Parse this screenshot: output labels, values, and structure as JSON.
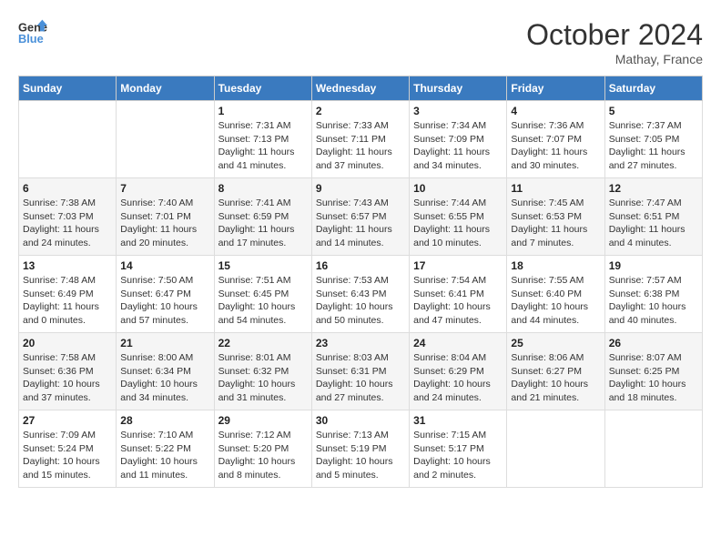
{
  "header": {
    "logo_line1": "General",
    "logo_line2": "Blue",
    "month": "October 2024",
    "location": "Mathay, France"
  },
  "columns": [
    "Sunday",
    "Monday",
    "Tuesday",
    "Wednesday",
    "Thursday",
    "Friday",
    "Saturday"
  ],
  "weeks": [
    [
      {
        "day": "",
        "info": ""
      },
      {
        "day": "",
        "info": ""
      },
      {
        "day": "1",
        "sunrise": "7:31 AM",
        "sunset": "7:13 PM",
        "daylight": "11 hours and 41 minutes."
      },
      {
        "day": "2",
        "sunrise": "7:33 AM",
        "sunset": "7:11 PM",
        "daylight": "11 hours and 37 minutes."
      },
      {
        "day": "3",
        "sunrise": "7:34 AM",
        "sunset": "7:09 PM",
        "daylight": "11 hours and 34 minutes."
      },
      {
        "day": "4",
        "sunrise": "7:36 AM",
        "sunset": "7:07 PM",
        "daylight": "11 hours and 30 minutes."
      },
      {
        "day": "5",
        "sunrise": "7:37 AM",
        "sunset": "7:05 PM",
        "daylight": "11 hours and 27 minutes."
      }
    ],
    [
      {
        "day": "6",
        "sunrise": "7:38 AM",
        "sunset": "7:03 PM",
        "daylight": "11 hours and 24 minutes."
      },
      {
        "day": "7",
        "sunrise": "7:40 AM",
        "sunset": "7:01 PM",
        "daylight": "11 hours and 20 minutes."
      },
      {
        "day": "8",
        "sunrise": "7:41 AM",
        "sunset": "6:59 PM",
        "daylight": "11 hours and 17 minutes."
      },
      {
        "day": "9",
        "sunrise": "7:43 AM",
        "sunset": "6:57 PM",
        "daylight": "11 hours and 14 minutes."
      },
      {
        "day": "10",
        "sunrise": "7:44 AM",
        "sunset": "6:55 PM",
        "daylight": "11 hours and 10 minutes."
      },
      {
        "day": "11",
        "sunrise": "7:45 AM",
        "sunset": "6:53 PM",
        "daylight": "11 hours and 7 minutes."
      },
      {
        "day": "12",
        "sunrise": "7:47 AM",
        "sunset": "6:51 PM",
        "daylight": "11 hours and 4 minutes."
      }
    ],
    [
      {
        "day": "13",
        "sunrise": "7:48 AM",
        "sunset": "6:49 PM",
        "daylight": "11 hours and 0 minutes."
      },
      {
        "day": "14",
        "sunrise": "7:50 AM",
        "sunset": "6:47 PM",
        "daylight": "10 hours and 57 minutes."
      },
      {
        "day": "15",
        "sunrise": "7:51 AM",
        "sunset": "6:45 PM",
        "daylight": "10 hours and 54 minutes."
      },
      {
        "day": "16",
        "sunrise": "7:53 AM",
        "sunset": "6:43 PM",
        "daylight": "10 hours and 50 minutes."
      },
      {
        "day": "17",
        "sunrise": "7:54 AM",
        "sunset": "6:41 PM",
        "daylight": "10 hours and 47 minutes."
      },
      {
        "day": "18",
        "sunrise": "7:55 AM",
        "sunset": "6:40 PM",
        "daylight": "10 hours and 44 minutes."
      },
      {
        "day": "19",
        "sunrise": "7:57 AM",
        "sunset": "6:38 PM",
        "daylight": "10 hours and 40 minutes."
      }
    ],
    [
      {
        "day": "20",
        "sunrise": "7:58 AM",
        "sunset": "6:36 PM",
        "daylight": "10 hours and 37 minutes."
      },
      {
        "day": "21",
        "sunrise": "8:00 AM",
        "sunset": "6:34 PM",
        "daylight": "10 hours and 34 minutes."
      },
      {
        "day": "22",
        "sunrise": "8:01 AM",
        "sunset": "6:32 PM",
        "daylight": "10 hours and 31 minutes."
      },
      {
        "day": "23",
        "sunrise": "8:03 AM",
        "sunset": "6:31 PM",
        "daylight": "10 hours and 27 minutes."
      },
      {
        "day": "24",
        "sunrise": "8:04 AM",
        "sunset": "6:29 PM",
        "daylight": "10 hours and 24 minutes."
      },
      {
        "day": "25",
        "sunrise": "8:06 AM",
        "sunset": "6:27 PM",
        "daylight": "10 hours and 21 minutes."
      },
      {
        "day": "26",
        "sunrise": "8:07 AM",
        "sunset": "6:25 PM",
        "daylight": "10 hours and 18 minutes."
      }
    ],
    [
      {
        "day": "27",
        "sunrise": "7:09 AM",
        "sunset": "5:24 PM",
        "daylight": "10 hours and 15 minutes."
      },
      {
        "day": "28",
        "sunrise": "7:10 AM",
        "sunset": "5:22 PM",
        "daylight": "10 hours and 11 minutes."
      },
      {
        "day": "29",
        "sunrise": "7:12 AM",
        "sunset": "5:20 PM",
        "daylight": "10 hours and 8 minutes."
      },
      {
        "day": "30",
        "sunrise": "7:13 AM",
        "sunset": "5:19 PM",
        "daylight": "10 hours and 5 minutes."
      },
      {
        "day": "31",
        "sunrise": "7:15 AM",
        "sunset": "5:17 PM",
        "daylight": "10 hours and 2 minutes."
      },
      {
        "day": "",
        "info": ""
      },
      {
        "day": "",
        "info": ""
      }
    ]
  ],
  "labels": {
    "sunrise": "Sunrise:",
    "sunset": "Sunset:",
    "daylight": "Daylight:"
  }
}
